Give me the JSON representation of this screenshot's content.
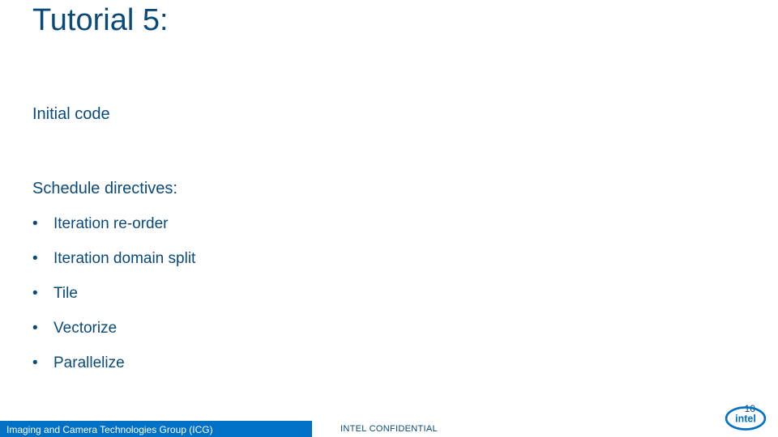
{
  "title": "Tutorial 5:",
  "subheading1": "Initial code",
  "subheading2": "Schedule directives:",
  "bullets": [
    "Iteration re-order",
    "Iteration domain split",
    "Tile",
    "Vectorize",
    "Parallelize"
  ],
  "footer_left": "Imaging and Camera Technologies Group (ICG)",
  "footer_center": "INTEL CONFIDENTIAL",
  "page_number": "10",
  "logo_name": "intel"
}
